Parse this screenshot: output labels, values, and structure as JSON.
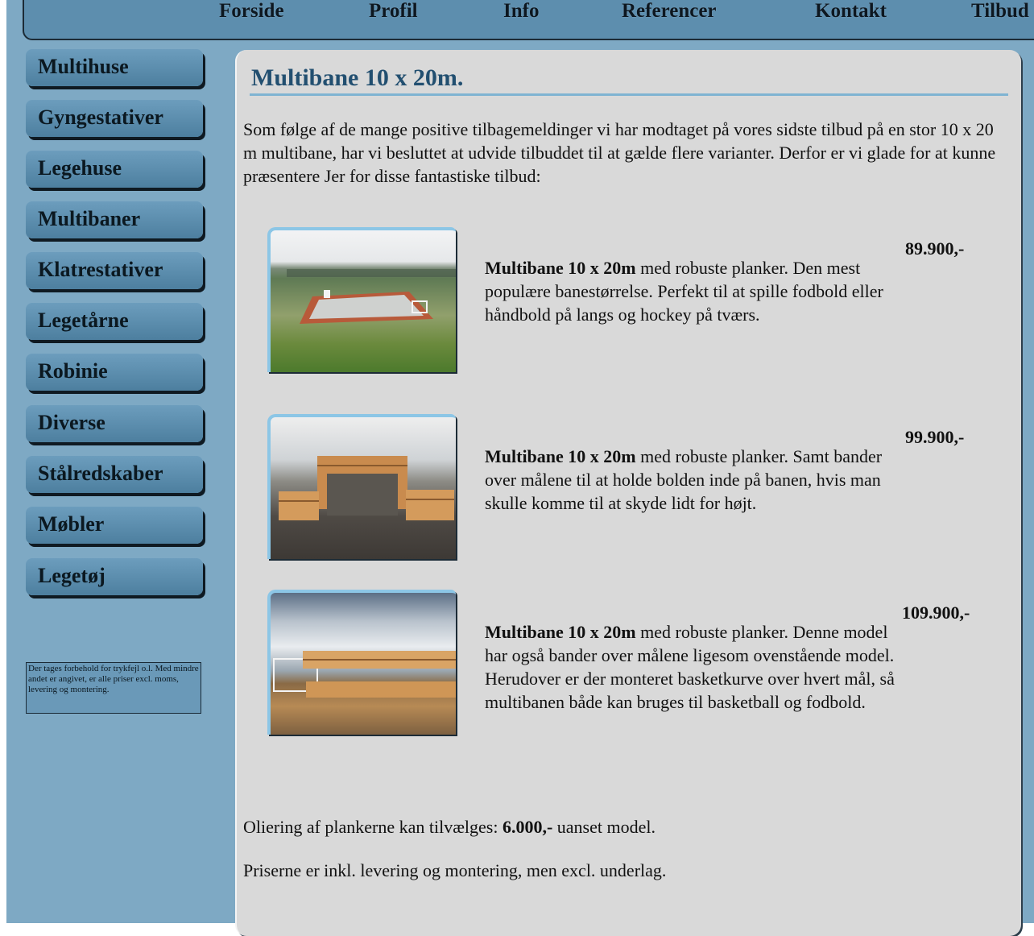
{
  "nav": {
    "items": [
      "Forside",
      "Profil",
      "Info",
      "Referencer",
      "Kontakt",
      "Tilbud"
    ]
  },
  "sidebar": {
    "items": [
      "Multihuse",
      "Gyngestativer",
      "Legehuse",
      "Multibaner",
      "Klatrestativer",
      "Legetårne",
      "Robinie",
      "Diverse",
      "Stålredskaber",
      "Møbler",
      "Legetøj"
    ],
    "disclaimer": "Der tages forbehold for trykfejl o.l. Med mindre andet er angivet, er alle priser excl. moms, levering og montering."
  },
  "main": {
    "title": "Multibane 10 x 20m.",
    "intro": "Som følge af de mange positive tilbagemeldinger vi har modtaget på vores sidste tilbud på en stor 10 x 20 m multibane, har vi besluttet at udvide tilbuddet til at gælde flere varianter. Derfor er vi glade for at kunne præsentere Jer for disse fantastiske tilbud:",
    "offers": [
      {
        "name": "Multibane 10 x 20m",
        "text": " med robuste planker. Den mest populære banestørrelse. Perfekt til at spille fodbold eller håndbold på langs og hockey på tværs.",
        "price": "89.900,-"
      },
      {
        "name": "Multibane 10 x 20m",
        "text": " med robuste planker. Samt bander over målene til at holde bolden inde på banen, hvis man skulle komme til at skyde lidt for højt.",
        "price": "99.900,-"
      },
      {
        "name": "Multibane 10 x 20m",
        "text": " med robuste planker. Denne model har også bander over målene ligesom ovenstående model. Herudover er der monteret basketkurve over hvert mål, så multibanen både kan bruges til basketball og fodbold.",
        "price": "109.900,-"
      }
    ],
    "oiling_prefix": "Oliering af plankerne kan tilvælges: ",
    "oiling_price": "6.000,-",
    "oiling_suffix": " uanset model.",
    "prices_note": "Priserne er inkl. levering og montering, men excl. underlag."
  },
  "colors": {
    "background": "#7ea9c4",
    "panel": "#d9d9d9",
    "title": "#224f70",
    "accent": "#7fb4d2"
  }
}
